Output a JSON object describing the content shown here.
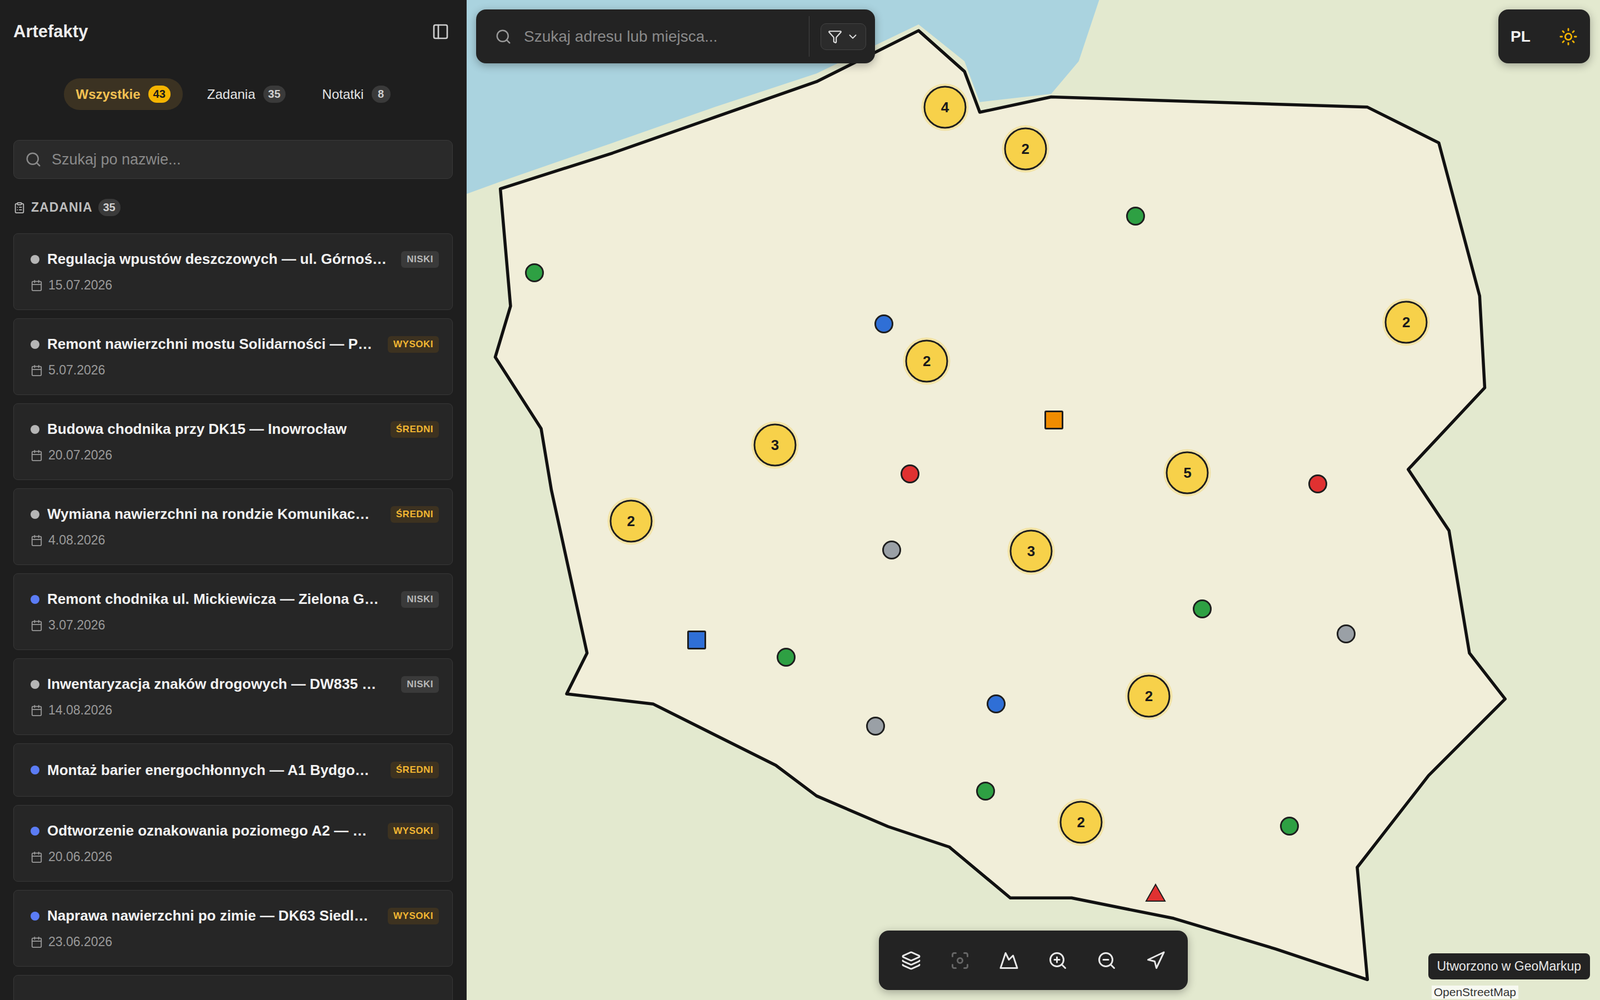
{
  "sidebar": {
    "title": "Artefakty",
    "tabs": [
      {
        "label": "Wszystkie",
        "count": "43",
        "selected": true
      },
      {
        "label": "Zadania",
        "count": "35",
        "selected": false
      },
      {
        "label": "Notatki",
        "count": "8",
        "selected": false
      }
    ],
    "search": {
      "placeholder": "Szukaj po nazwie..."
    },
    "section": {
      "label": "ZADANIA",
      "count": "35"
    },
    "tasks": [
      {
        "title": "Regulacja wpustów deszczowych — ul. Górnoś…",
        "priority": "NISKI",
        "priority_color": "#b8b8b8",
        "date": "15.07.2026",
        "color": "#b5b5b5"
      },
      {
        "title": "Remont nawierzchni mostu Solidarności — P…",
        "priority": "WYSOKI",
        "priority_color": "#f2b632",
        "date": "5.07.2026",
        "color": "#b5b5b5"
      },
      {
        "title": "Budowa chodnika przy DK15 — Inowrocław",
        "priority": "ŚREDNI",
        "priority_color": "#f2b632",
        "date": "20.07.2026",
        "color": "#b5b5b5"
      },
      {
        "title": "Wymiana nawierzchni na rondzie Komunikac…",
        "priority": "ŚREDNI",
        "priority_color": "#f2b632",
        "date": "4.08.2026",
        "color": "#b5b5b5"
      },
      {
        "title": "Remont chodnika ul. Mickiewicza — Zielona G…",
        "priority": "NISKI",
        "priority_color": "#b8b8b8",
        "date": "3.07.2026",
        "color": "#5b7cf5"
      },
      {
        "title": "Inwentaryzacja znaków drogowych — DW835 …",
        "priority": "NISKI",
        "priority_color": "#b8b8b8",
        "date": "14.08.2026",
        "color": "#b5b5b5"
      },
      {
        "title": "Montaż barier energochłonnych — A1 Bydgo…",
        "priority": "ŚREDNI",
        "priority_color": "#f2b632",
        "color": "#5b7cf5"
      },
      {
        "title": "Odtworzenie oznakowania poziomego A2 — …",
        "priority": "WYSOKI",
        "priority_color": "#f2b632",
        "date": "20.06.2026",
        "color": "#5b7cf5"
      },
      {
        "title": "Naprawa nawierzchni po zimie — DK63 Siedl…",
        "priority": "WYSOKI",
        "priority_color": "#f2b632",
        "date": "23.06.2026",
        "color": "#5b7cf5"
      }
    ]
  },
  "map": {
    "search": {
      "placeholder": "Szukaj adresu lub miejsca..."
    },
    "language": "PL",
    "markers": [
      {
        "kind": "cluster",
        "count": "4",
        "color": "#f7d14a"
      },
      {
        "kind": "cluster",
        "count": "2",
        "color": "#f7d14a"
      },
      {
        "kind": "cluster",
        "count": "2",
        "color": "#f7d14a"
      },
      {
        "kind": "cluster",
        "count": "3",
        "color": "#f7d14a"
      },
      {
        "kind": "cluster",
        "count": "2",
        "color": "#f7d14a"
      },
      {
        "kind": "cluster",
        "count": "5",
        "color": "#f7d14a"
      },
      {
        "kind": "cluster",
        "count": "3",
        "color": "#f7d14a"
      },
      {
        "kind": "cluster",
        "count": "2",
        "color": "#f7d14a"
      },
      {
        "kind": "cluster",
        "count": "2",
        "color": "#f7d14a"
      },
      {
        "kind": "cluster",
        "count": "2",
        "color": "#f7d14a"
      },
      {
        "kind": "circle",
        "color": "#2ea043"
      },
      {
        "kind": "circle",
        "color": "#2ea043"
      },
      {
        "kind": "circle",
        "color": "#2f6fd6"
      },
      {
        "kind": "square",
        "color": "#f08c00"
      },
      {
        "kind": "circle",
        "color": "#e03131"
      },
      {
        "kind": "circle",
        "color": "#e03131"
      },
      {
        "kind": "circle",
        "color": "#9aa0a6"
      },
      {
        "kind": "circle",
        "color": "#2ea043"
      },
      {
        "kind": "circle",
        "color": "#9aa0a6"
      },
      {
        "kind": "square",
        "color": "#2f6fd6"
      },
      {
        "kind": "circle",
        "color": "#2ea043"
      },
      {
        "kind": "circle",
        "color": "#9aa0a6"
      },
      {
        "kind": "circle",
        "color": "#2f6fd6"
      },
      {
        "kind": "circle",
        "color": "#2ea043"
      },
      {
        "kind": "circle",
        "color": "#2ea043"
      },
      {
        "kind": "triangle",
        "color": "#e03131"
      }
    ],
    "toolbar": [
      {
        "disabled": false
      },
      {
        "disabled": true
      },
      {
        "disabled": false
      },
      {
        "disabled": false
      },
      {
        "disabled": false
      },
      {
        "disabled": false
      }
    ],
    "attribution": "Utworzono w GeoMarkup",
    "credit": "OpenStreetMap"
  }
}
